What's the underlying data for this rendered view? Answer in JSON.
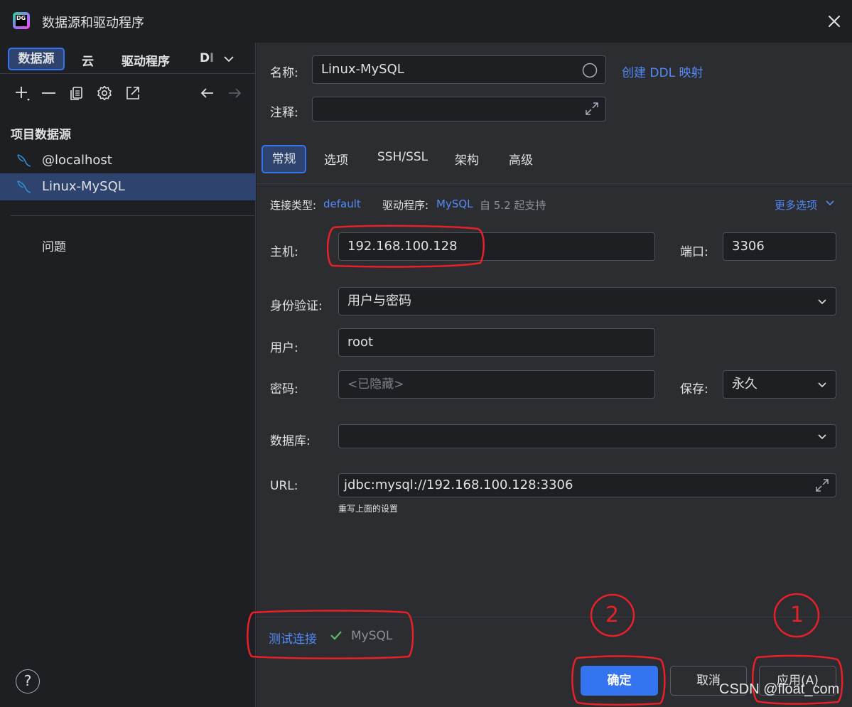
{
  "window": {
    "title": "数据源和驱动程序",
    "app_icon_text": "DG"
  },
  "left_tabs": {
    "datasource": "数据源",
    "cloud": "云",
    "drivers": "驱动程序",
    "ddl": "DI"
  },
  "left": {
    "section_title": "项目数据源",
    "items": [
      {
        "label": "@localhost"
      },
      {
        "label": "Linux-MySQL"
      }
    ],
    "problems": "问题"
  },
  "form": {
    "name_label": "名称:",
    "name_value": "Linux-MySQL",
    "ddl_link": "创建 DDL 映射",
    "comment_label": "注释:",
    "comment_value": ""
  },
  "tabs": [
    "常规",
    "选项",
    "SSH/SSL",
    "架构",
    "高级"
  ],
  "conn": {
    "type_label": "连接类型:",
    "type_value": "default",
    "driver_label": "驱动程序:",
    "driver_value": "MySQL",
    "driver_note": "自 5.2 起支持",
    "more_options": "更多选项",
    "host_label": "主机:",
    "host_value": "192.168.100.128",
    "port_label": "端口:",
    "port_value": "3306",
    "auth_label": "身份验证:",
    "auth_value": "用户与密码",
    "user_label": "用户:",
    "user_value": "root",
    "password_label": "密码:",
    "password_placeholder": "<已隐藏>",
    "save_label": "保存:",
    "save_value": "永久",
    "database_label": "数据库:",
    "database_value": "",
    "url_label": "URL:",
    "url_value": "jdbc:mysql://192.168.100.128:3306",
    "url_note": "重写上面的设置"
  },
  "test": {
    "link": "测试连接",
    "result": "MySQL"
  },
  "buttons": {
    "help": "?",
    "ok": "确定",
    "cancel": "取消",
    "apply": "应用(A)"
  },
  "annotations": {
    "step1": "1",
    "step2": "2"
  },
  "watermark": "CSDN @float_com",
  "colors": {
    "accent": "#3574f0",
    "link": "#548af7",
    "success": "#5fb865",
    "annotation": "#e8202a"
  }
}
